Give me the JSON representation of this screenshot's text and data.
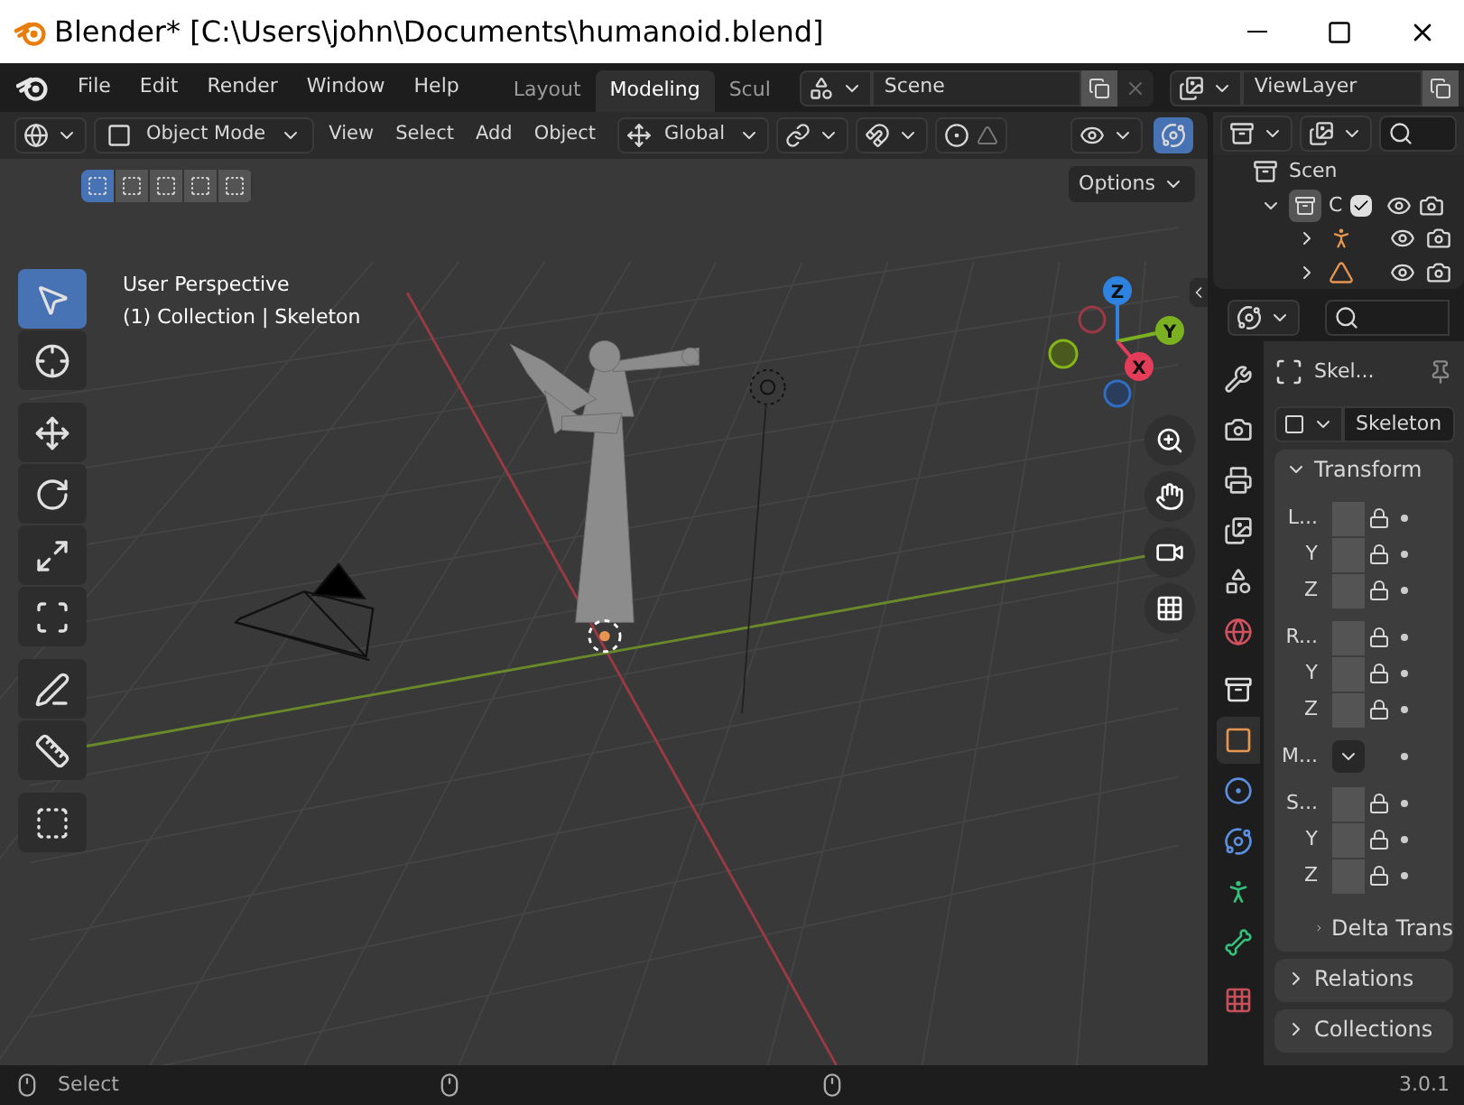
{
  "window": {
    "title": "Blender* [C:\\Users\\john\\Documents\\humanoid.blend]"
  },
  "menu": [
    "File",
    "Edit",
    "Render",
    "Window",
    "Help"
  ],
  "workspaces": [
    {
      "label": "Layout",
      "selected": false
    },
    {
      "label": "Modeling",
      "selected": true
    },
    {
      "label": "Scul",
      "selected": false
    }
  ],
  "scene": "Scene",
  "view_layer": "ViewLayer",
  "header": {
    "mode": "Object Mode",
    "menus": [
      "View",
      "Select",
      "Add",
      "Object"
    ],
    "orientation": "Global",
    "gizmos_on": true
  },
  "select_modes": [
    {
      "selected": true
    },
    {
      "selected": false
    },
    {
      "selected": false
    },
    {
      "selected": false
    },
    {
      "selected": false
    }
  ],
  "options": "Options",
  "viewport": {
    "info": [
      "User Perspective",
      "(1) Collection | Skeleton"
    ],
    "axes": [
      "X",
      "Y",
      "Z"
    ]
  },
  "tools": [
    {
      "kind": "select",
      "selected": true
    },
    {
      "kind": "cursor",
      "selected": false
    },
    {
      "kind": "move",
      "selected": false
    },
    {
      "kind": "rotate",
      "selected": false
    },
    {
      "kind": "scale",
      "selected": false
    },
    {
      "kind": "transform",
      "selected": false
    },
    {
      "kind": "annotate",
      "selected": false
    },
    {
      "kind": "measure",
      "selected": false
    },
    {
      "kind": "add_cube",
      "selected": false
    }
  ],
  "outliner": {
    "root": "Scen",
    "items": [
      {
        "label": "C",
        "expanded": true,
        "checked": true,
        "children": [
          {
            "kind": "armature",
            "expanded": false
          },
          {
            "kind": "mesh",
            "expanded": false
          }
        ]
      }
    ]
  },
  "properties": {
    "tabs": [
      {
        "kind": "tool",
        "selected": false
      },
      {
        "kind": "render",
        "selected": false
      },
      {
        "kind": "output",
        "selected": false
      },
      {
        "kind": "view_layer",
        "selected": false
      },
      {
        "kind": "scene",
        "selected": false
      },
      {
        "kind": "world",
        "selected": false
      },
      {
        "kind": "collection",
        "selected": false
      },
      {
        "kind": "object",
        "selected": true
      },
      {
        "kind": "physics",
        "selected": false
      },
      {
        "kind": "constraints",
        "selected": false
      },
      {
        "kind": "data",
        "selected": false
      },
      {
        "kind": "bone",
        "selected": false
      },
      {
        "kind": "texture",
        "selected": false
      }
    ],
    "object_name": "Skel...",
    "data_name": "Skeleton",
    "panels": [
      {
        "title": "Transform",
        "expanded": true,
        "groups": [
          [
            {
              "label": "L...",
              "kind": "field"
            },
            {
              "label": "Y",
              "kind": "field"
            },
            {
              "label": "Z",
              "kind": "field"
            }
          ],
          [
            {
              "label": "R...",
              "kind": "field"
            },
            {
              "label": "Y",
              "kind": "field"
            },
            {
              "label": "Z",
              "kind": "field"
            }
          ],
          [
            {
              "label": "M...",
              "kind": "dropdown"
            }
          ],
          [
            {
              "label": "S...",
              "kind": "field"
            },
            {
              "label": "Y",
              "kind": "field"
            },
            {
              "label": "Z",
              "kind": "field"
            }
          ]
        ],
        "subpanels": [
          {
            "title": "Delta Trans",
            "expanded": false
          }
        ]
      },
      {
        "title": "Relations",
        "expanded": false
      },
      {
        "title": "Collections",
        "expanded": false
      }
    ]
  },
  "status_bar": {
    "hint": "Select",
    "version": "3.0.1"
  }
}
